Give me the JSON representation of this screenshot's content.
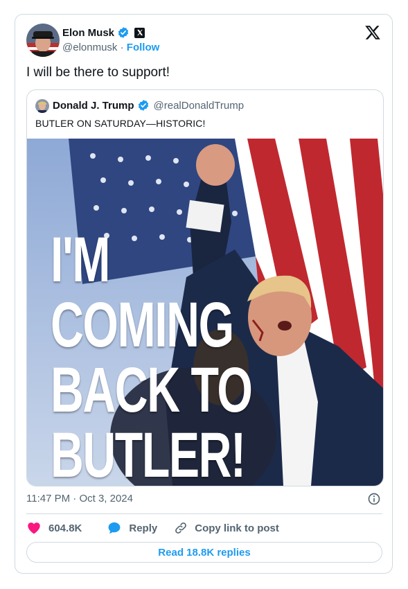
{
  "author": {
    "name": "Elon Musk",
    "handle": "@elonmusk",
    "separator": "·",
    "follow_label": "Follow"
  },
  "tweet": {
    "text": "I will be there to support!",
    "time": "11:47 PM",
    "date_separator": "·",
    "date": "Oct 3, 2024"
  },
  "quoted": {
    "name": "Donald J. Trump",
    "handle": "@realDonaldTrump",
    "text": "BUTLER ON SATURDAY—HISTORIC!",
    "image_headline": [
      "I'M",
      "COMING",
      "BACK TO",
      "BUTLER!"
    ]
  },
  "actions": {
    "likes": "604.8K",
    "reply_label": "Reply",
    "copy_label": "Copy link to post",
    "read_replies_label": "Read 18.8K replies"
  },
  "colors": {
    "accent": "#1d9bf0",
    "like": "#f91880",
    "text": "#0f1419",
    "secondary": "#536471",
    "border": "#cfd9de"
  },
  "icons": [
    "verified-badge-icon",
    "x-affiliation-icon",
    "x-logo-icon",
    "info-icon",
    "heart-icon",
    "reply-bubble-icon",
    "link-icon"
  ]
}
